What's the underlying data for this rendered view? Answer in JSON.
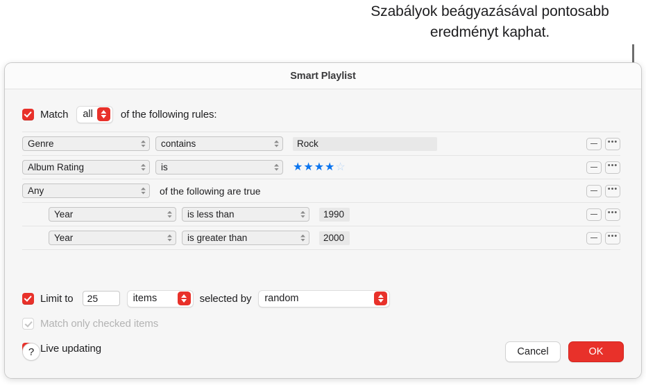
{
  "callout": {
    "text": "Szabályok beágyazásával pontosabb eredményt kaphat."
  },
  "dialog": {
    "title": "Smart Playlist",
    "match": {
      "checked": true,
      "prefix_label": "Match",
      "selected": "all",
      "suffix_label": "of the following rules:"
    },
    "rules": [
      {
        "type": "rule",
        "indent": false,
        "field": "Genre",
        "operator": "contains",
        "value_type": "text",
        "value": "Rock",
        "remove_label": "−",
        "more_label": "•••"
      },
      {
        "type": "rule",
        "indent": false,
        "field": "Album Rating",
        "operator": "is",
        "value_type": "stars",
        "stars_filled": 4,
        "stars_total": 5,
        "star_filled_glyph": "★",
        "star_empty_glyph": "☆",
        "remove_label": "−",
        "more_label": "•••"
      },
      {
        "type": "group",
        "indent": false,
        "field": "Any",
        "group_label": "of the following are true",
        "remove_label": "−",
        "more_label": "•••"
      },
      {
        "type": "rule",
        "indent": true,
        "field": "Year",
        "operator": "is less than",
        "value_type": "number",
        "value": "1990",
        "remove_label": "−",
        "more_label": "•••"
      },
      {
        "type": "rule",
        "indent": true,
        "field": "Year",
        "operator": "is greater than",
        "value_type": "number",
        "value": "2000",
        "remove_label": "−",
        "more_label": "•••"
      }
    ],
    "options": {
      "limit": {
        "checked": true,
        "label": "Limit to",
        "amount": "25",
        "unit": "items",
        "selected_by_label": "selected by",
        "selected_by": "random"
      },
      "match_checked": {
        "checked": true,
        "enabled": false,
        "label": "Match only checked items"
      },
      "live_updating": {
        "checked": true,
        "label": "Live updating"
      }
    },
    "footer": {
      "help_label": "?",
      "cancel_label": "Cancel",
      "ok_label": "OK"
    }
  },
  "colors": {
    "accent_red": "#e8312a",
    "star_blue": "#0a74ef",
    "star_blue_empty": "#b8d6f7",
    "window_bg": "#f6f6f6",
    "callout_line": "#6e6e6e",
    "bracket": "#8a8a8a"
  }
}
